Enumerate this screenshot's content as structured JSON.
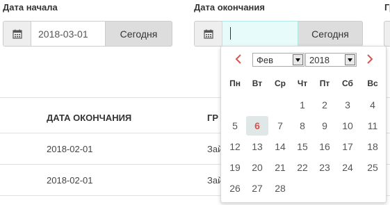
{
  "filters": {
    "start": {
      "label": "Дата начала",
      "value": "2018-03-01",
      "today_label": "Сегодня"
    },
    "end": {
      "label": "Дата окончания",
      "value": "",
      "today_label": "Сегодня"
    },
    "third_label_partial": "Гр"
  },
  "table": {
    "headers": {
      "end_date": "ДАТА ОКОНЧАНИЯ",
      "group_partial": "ГР"
    },
    "rows": [
      {
        "end_date": "2018-02-01",
        "group_partial": "Зай"
      },
      {
        "end_date": "2018-02-01",
        "group_partial": "Зай"
      }
    ]
  },
  "datepicker": {
    "month": "Фев",
    "year": "2018",
    "weekdays": [
      "Пн",
      "Вт",
      "Ср",
      "Чт",
      "Пт",
      "Сб",
      "Вс"
    ],
    "weeks": [
      [
        "",
        "",
        "",
        "1",
        "2",
        "3",
        "4"
      ],
      [
        "5",
        "6",
        "7",
        "8",
        "9",
        "10",
        "11"
      ],
      [
        "12",
        "13",
        "14",
        "15",
        "16",
        "17",
        "18"
      ],
      [
        "19",
        "20",
        "21",
        "22",
        "23",
        "24",
        "25"
      ],
      [
        "26",
        "27",
        "28",
        "",
        "",
        "",
        ""
      ]
    ],
    "today": "6",
    "icons": {
      "prev": "chevron-left-icon",
      "next": "chevron-right-icon",
      "calendar": "calendar-icon"
    },
    "colors": {
      "arrow": "#d9534f",
      "today_text": "#d9534f",
      "focused_input": "#e8fbfb"
    }
  }
}
